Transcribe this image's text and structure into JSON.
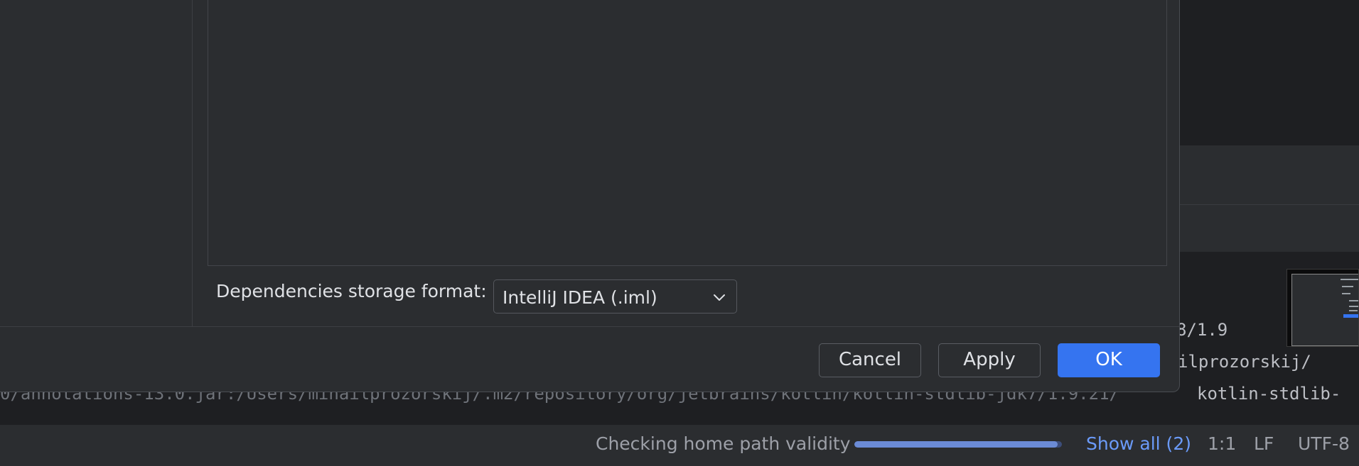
{
  "dialog": {
    "deps_label": "Dependencies storage format:",
    "deps_select_value": "IntelliJ IDEA (.iml)",
    "buttons": {
      "cancel": "Cancel",
      "apply": "Apply",
      "ok": "OK"
    }
  },
  "editor": {
    "lines": [
      "8/1.9",
      "ilprozorskij/",
      "0/annotations-13.0.jar:/Users/mihailprozorskij/.m2/repository/org/jetbrains/kotlin/kotlin-stdlib-jdk7/1.9.21/",
      "kotlin-stdlib-"
    ]
  },
  "statusbar": {
    "task": "Checking home path validity",
    "progress": 0.98,
    "show_all": "Show all (2)",
    "position": "1:1",
    "line_ending": "LF",
    "encoding": "UTF-8"
  },
  "colors": {
    "accent": "#3574f0",
    "link": "#6b9bfa",
    "dialog_bg": "#2b2d30",
    "editor_bg": "#1e1f22"
  },
  "icons": [
    "chevron-down-icon"
  ]
}
